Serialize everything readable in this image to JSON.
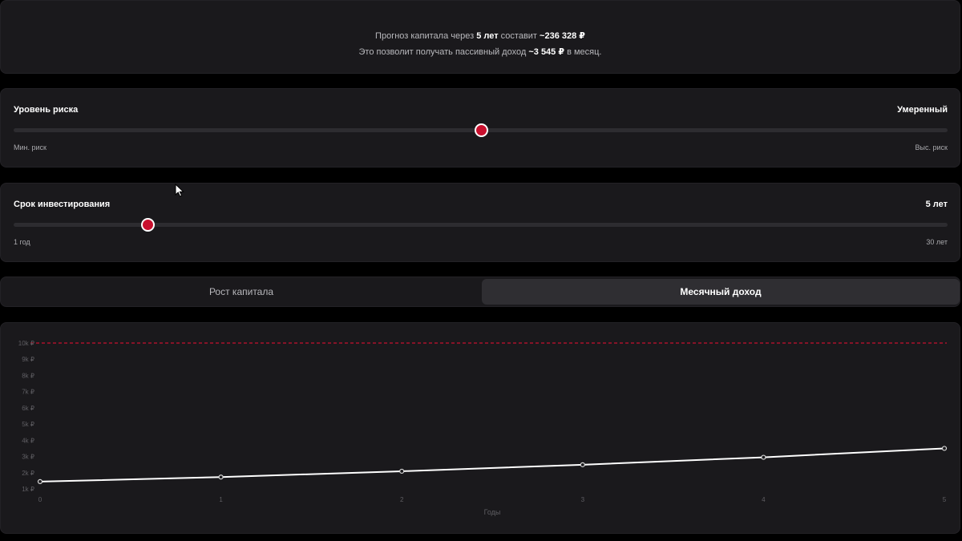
{
  "summary": {
    "line1_pre": "Прогноз капитала через",
    "line1_years": "5 лет",
    "line1_mid": "составит",
    "line1_amount": "~236 328 ₽",
    "line2_pre": "Это позволит получать пассивный доход",
    "line2_amount": "~3 545 ₽",
    "line2_post": "в месяц."
  },
  "risk": {
    "title": "Уровень риска",
    "value": "Умеренный",
    "min_label": "Мин. риск",
    "max_label": "Выс. риск",
    "position": 0.5
  },
  "term": {
    "title": "Срок инвестирования",
    "value": "5 лет",
    "min_label": "1 год",
    "max_label": "30 лет",
    "position": 0.143
  },
  "tabs": [
    {
      "label": "Рост капитала",
      "active": false
    },
    {
      "label": "Месячный доход",
      "active": true
    }
  ],
  "colors": {
    "accent": "#c8102e",
    "background": "#000000",
    "card": "#1a191c",
    "line": "#ffffff",
    "target_line": "#c8102e"
  },
  "chart_data": {
    "type": "line",
    "x": [
      0,
      1,
      2,
      3,
      4,
      5
    ],
    "series": [
      {
        "values": [
          1450,
          1730,
          2090,
          2490,
          2950,
          3500
        ]
      }
    ],
    "target": 10000,
    "xlabel": "Годы",
    "ylabel": "",
    "x_ticks": [
      "0",
      "1",
      "2",
      "3",
      "4",
      "5"
    ],
    "y_ticks": [
      {
        "value": 1000,
        "label": "1k ₽"
      },
      {
        "value": 2000,
        "label": "2k ₽"
      },
      {
        "value": 3000,
        "label": "3k ₽"
      },
      {
        "value": 4000,
        "label": "4k ₽"
      },
      {
        "value": 5000,
        "label": "5k ₽"
      },
      {
        "value": 6000,
        "label": "6k ₽"
      },
      {
        "value": 7000,
        "label": "7k ₽"
      },
      {
        "value": 8000,
        "label": "8k ₽"
      },
      {
        "value": 9000,
        "label": "9k ₽"
      },
      {
        "value": 10000,
        "label": "10k ₽"
      }
    ],
    "xlim": [
      0,
      5
    ],
    "ylim": [
      1000,
      10000
    ],
    "grid": false
  }
}
